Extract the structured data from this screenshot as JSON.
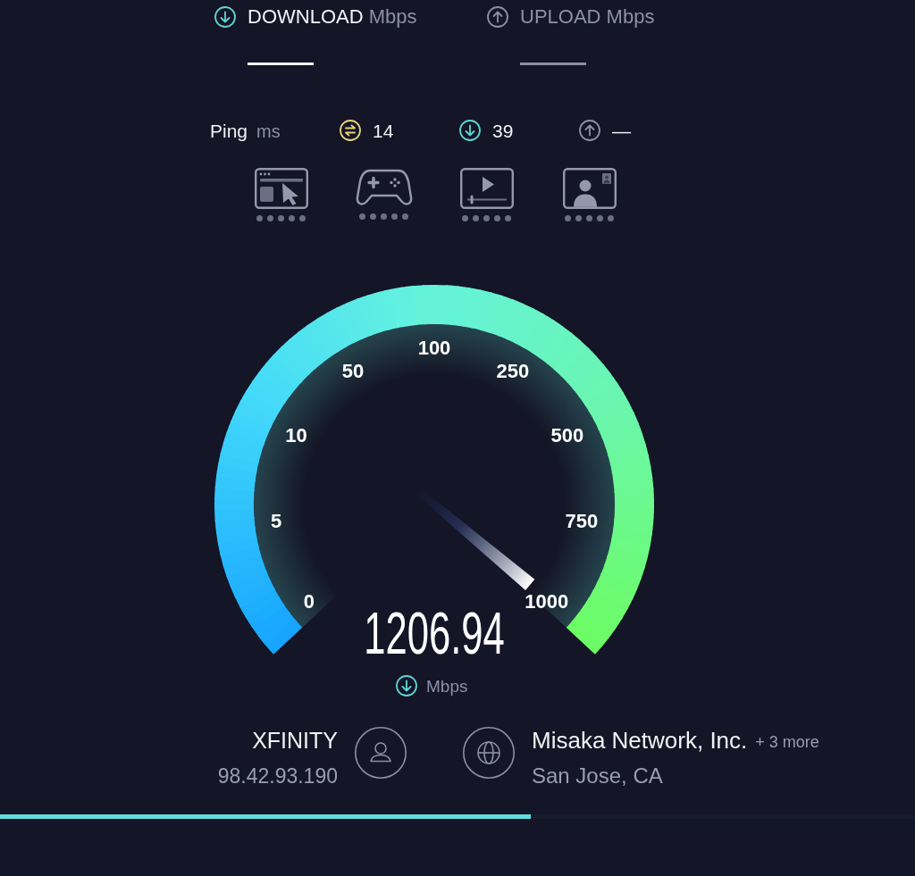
{
  "tabs": [
    {
      "kind": "download",
      "label": "DOWNLOAD",
      "unit": "Mbps",
      "selected": true
    },
    {
      "kind": "upload",
      "label": "UPLOAD",
      "unit": "Mbps",
      "selected": false
    }
  ],
  "ping": {
    "label": "Ping",
    "unit": "ms",
    "stats": [
      {
        "kind": "idle",
        "value": "14"
      },
      {
        "kind": "download",
        "value": "39"
      },
      {
        "kind": "upload",
        "value": "—"
      }
    ]
  },
  "gauge": {
    "ticks": [
      "0",
      "5",
      "10",
      "50",
      "100",
      "250",
      "500",
      "750",
      "1000"
    ],
    "level": 1,
    "value": "1206.94",
    "kind": "download",
    "unit": "Mbps"
  },
  "client": {
    "name": "XFINITY",
    "ip": "98.42.93.190"
  },
  "server": {
    "name": "Misaka Network, Inc.",
    "more": "+ 3 more",
    "location": "San Jose, CA"
  },
  "progress": {
    "level": 0.58
  }
}
